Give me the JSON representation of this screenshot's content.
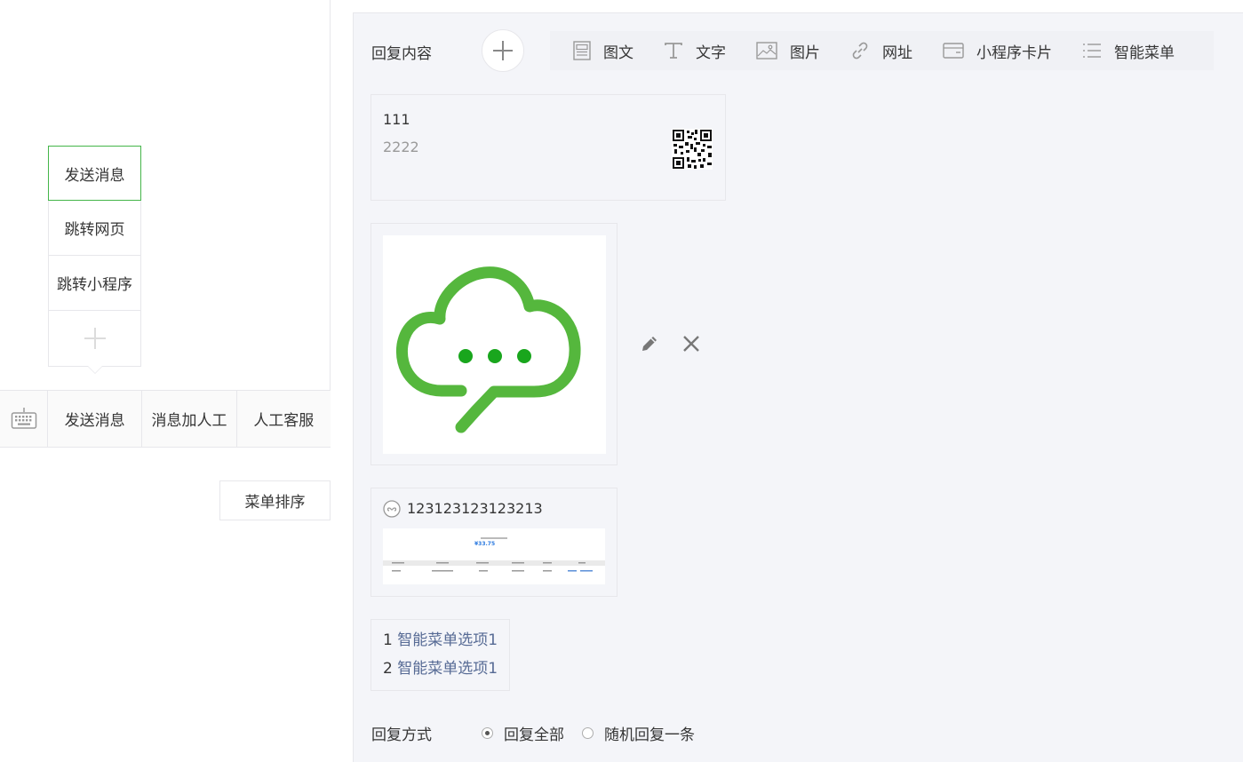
{
  "preview": {
    "submenu": [
      "发送消息",
      "跳转网页",
      "跳转小程序"
    ],
    "menubar": [
      "发送消息",
      "消息加人工",
      "人工客服"
    ],
    "sort_button": "菜单排序"
  },
  "reply": {
    "label": "回复内容",
    "toolbar": [
      "图文",
      "文字",
      "图片",
      "网址",
      "小程序卡片",
      "智能菜单"
    ],
    "text_card": {
      "title": "111",
      "desc": "2222"
    },
    "miniprogram_card": {
      "title": "123123123123213",
      "thumb_amount": "¥33.75"
    },
    "smart_menu": [
      {
        "num": "1",
        "text": "智能菜单选项1"
      },
      {
        "num": "2",
        "text": "智能菜单选项1"
      }
    ],
    "mode_label": "回复方式",
    "mode_options": [
      "回复全部",
      "随机回复一条"
    ],
    "mode_selected": "回复全部"
  },
  "colors": {
    "accent": "#44b549",
    "link": "#576b95",
    "panel_bg": "#f4f5f9"
  }
}
